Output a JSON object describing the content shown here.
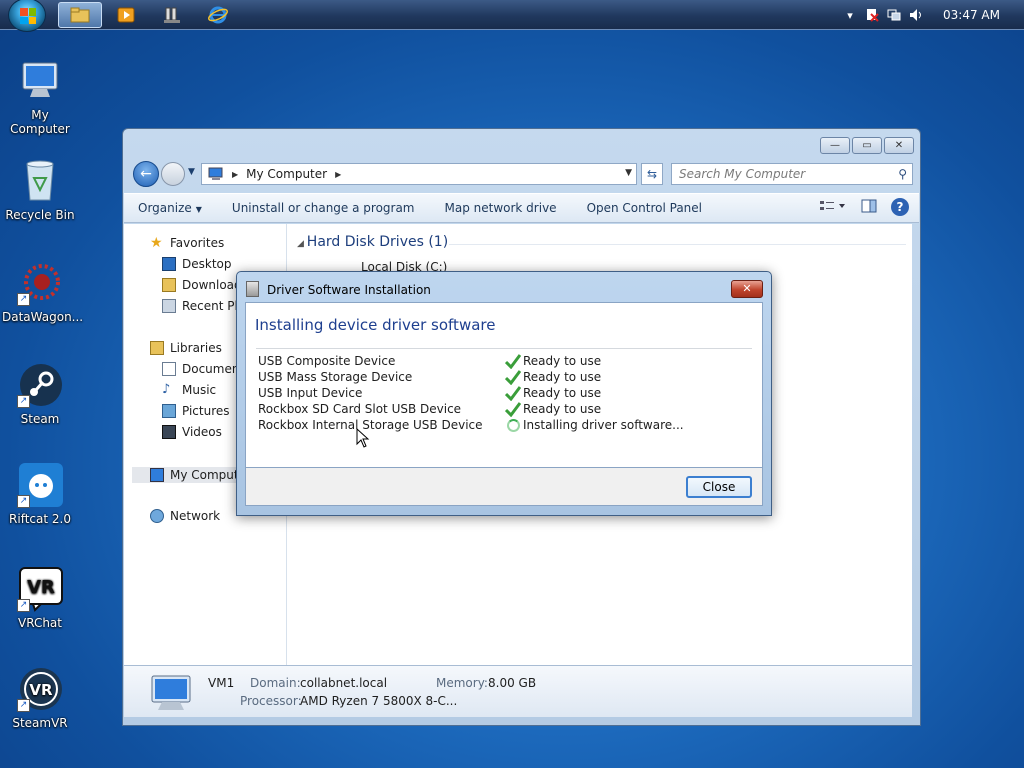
{
  "taskbar": {
    "clock": "03:47 AM",
    "pinned": [
      {
        "name": "explorer",
        "icon": "folder-icon"
      },
      {
        "name": "media-player",
        "icon": "media-player-icon"
      },
      {
        "name": "device-app",
        "icon": "device-icon"
      },
      {
        "name": "internet-explorer",
        "icon": "ie-icon"
      }
    ]
  },
  "desktop": {
    "icons": [
      {
        "label": "My Computer",
        "icon": "computer-icon"
      },
      {
        "label": "Recycle Bin",
        "icon": "recycle-bin-icon"
      },
      {
        "label": "DataWagon...",
        "icon": "datawagon-icon"
      },
      {
        "label": "Steam",
        "icon": "steam-icon"
      },
      {
        "label": "Riftcat 2.0",
        "icon": "riftcat-icon"
      },
      {
        "label": "VRChat",
        "icon": "vrchat-icon"
      },
      {
        "label": "SteamVR",
        "icon": "steamvr-icon"
      }
    ]
  },
  "explorer": {
    "address": "My Computer",
    "search_placeholder": "Search My Computer",
    "commands": {
      "organize": "Organize",
      "uninstall": "Uninstall or change a program",
      "map_drive": "Map network drive",
      "control_panel": "Open Control Panel"
    },
    "nav": {
      "favorites": "Favorites",
      "desktop": "Desktop",
      "downloads": "Download",
      "recent": "Recent Pla",
      "libraries": "Libraries",
      "documents": "Document",
      "music": "Music",
      "pictures": "Pictures",
      "videos": "Videos",
      "my_computer": "My Comput",
      "network": "Network"
    },
    "group_title": "Hard Disk Drives (1)",
    "local_disk": "Local Disk (C:)",
    "details": {
      "name": "VM1",
      "domain_label": "Domain:",
      "domain": "collabnet.local",
      "memory_label": "Memory:",
      "memory": "8.00 GB",
      "processor_label": "Processor:",
      "processor": "AMD Ryzen 7 5800X 8-C..."
    }
  },
  "dialog": {
    "title": "Driver Software Installation",
    "heading": "Installing device driver software",
    "close_button": "Close",
    "devices": [
      {
        "name": "USB Composite Device",
        "status": "Ready to use",
        "state": "done"
      },
      {
        "name": "USB Mass Storage Device",
        "status": "Ready to use",
        "state": "done"
      },
      {
        "name": "USB Input Device",
        "status": "Ready to use",
        "state": "done"
      },
      {
        "name": "Rockbox SD Card Slot USB Device",
        "status": "Ready to use",
        "state": "done"
      },
      {
        "name": "Rockbox Internal Storage USB Device",
        "status": "Installing driver software...",
        "state": "installing"
      }
    ]
  }
}
